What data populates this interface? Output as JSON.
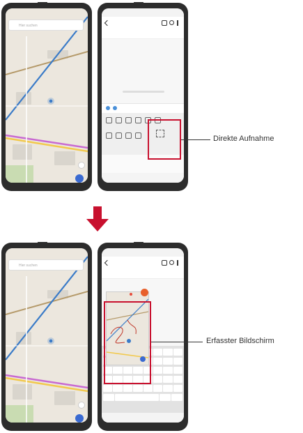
{
  "callouts": {
    "top_label": "Direkte Aufnahme",
    "bottom_label": "Erfasster Bildschirm"
  },
  "map": {
    "search_placeholder": "Hier suchen"
  },
  "colors": {
    "highlight": "#c8102e",
    "route_blue": "#3a7bc8",
    "road_yellow": "#f2c94c",
    "road_purple": "#c86ad1",
    "arrow": "#c8102e"
  },
  "icons": [
    "arrow-down-icon",
    "close-icon",
    "phone-icon",
    "search-icon",
    "menu-icon",
    "navigation-icon"
  ]
}
